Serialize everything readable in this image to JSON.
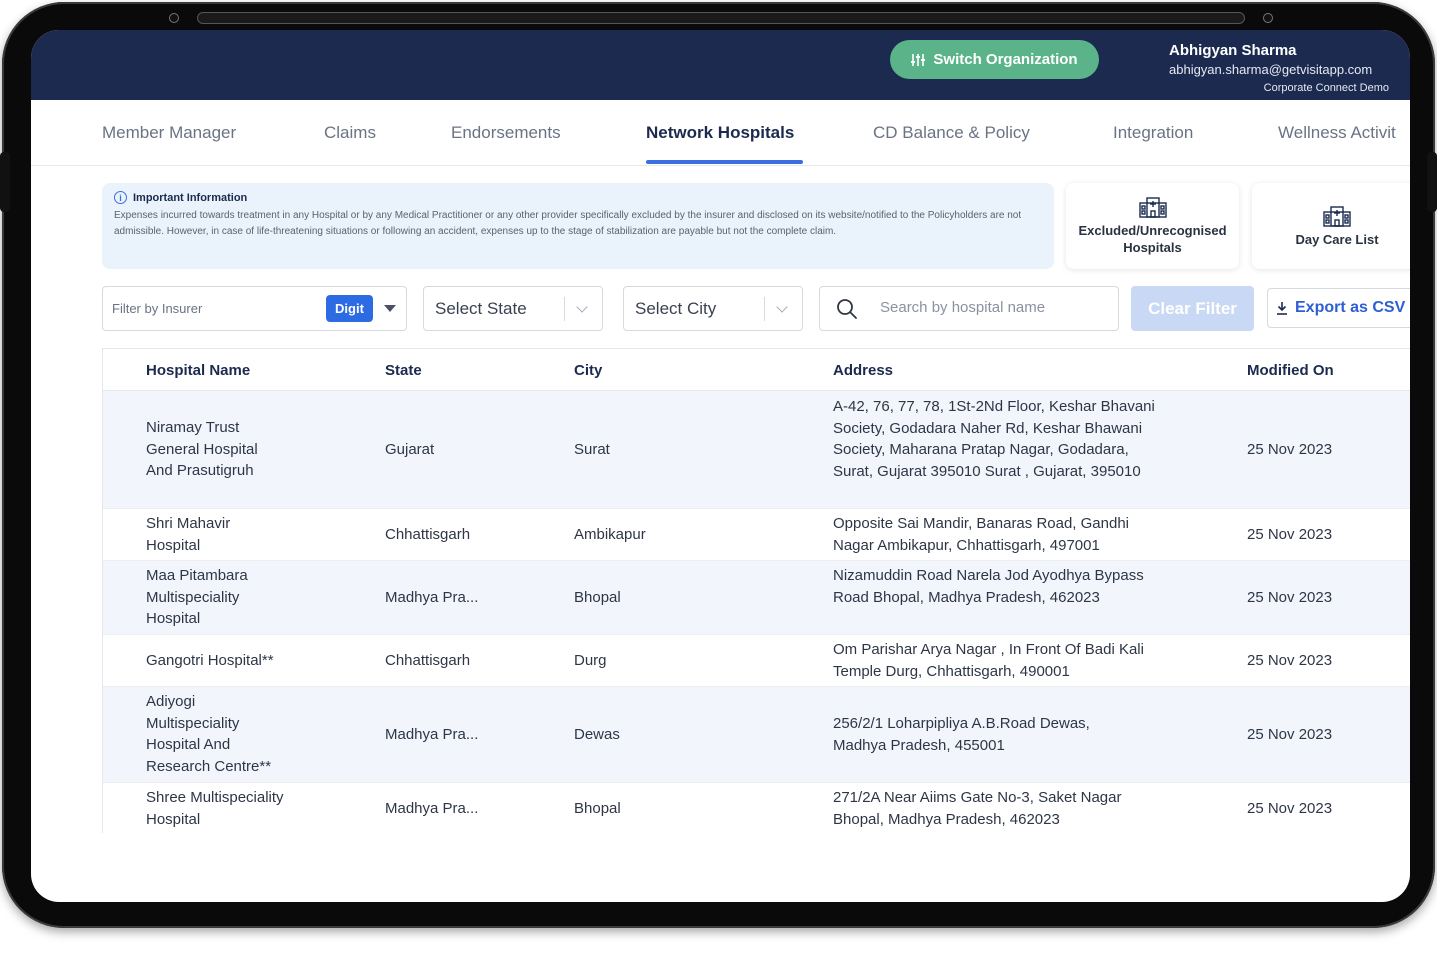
{
  "header": {
    "switch_label": "Switch Organization",
    "user_name": "Abhigyan Sharma",
    "user_email": "abhigyan.sharma@getvisitapp.com",
    "org_name": "Corporate Connect Demo"
  },
  "tabs": [
    {
      "label": "Member Manager"
    },
    {
      "label": "Claims"
    },
    {
      "label": "Endorsements"
    },
    {
      "label": "Network Hospitals"
    },
    {
      "label": "CD Balance & Policy"
    },
    {
      "label": "Integration"
    },
    {
      "label": "Wellness Activit"
    }
  ],
  "active_tab": "Network Hospitals",
  "info": {
    "title": "Important Information",
    "text": "Expenses incurred towards treatment in any Hospital or by any Medical Practitioner or any other provider specifically excluded by the insurer and disclosed on its website/notified to the Policyholders are not admissible. However, in case of life-threatening situations or following an accident, expenses up to the stage of stabilization are payable but not the complete claim."
  },
  "cards": {
    "excluded": "Excluded/Unrecognised Hospitals",
    "daycare": "Day Care List"
  },
  "filters": {
    "insurer_label": "Filter by Insurer",
    "insurer_chip": "Digit",
    "state_placeholder": "Select State",
    "city_placeholder": "Select City",
    "search_placeholder": "Search by hospital name",
    "clear_label": "Clear Filter",
    "export_label": "Export as CSV"
  },
  "table": {
    "columns": {
      "name": "Hospital Name",
      "state": "State",
      "city": "City",
      "address": "Address",
      "modified": "Modified On"
    },
    "rows": [
      {
        "name": "Niramay Trust General Hospital And Prasutigruh",
        "state": "Gujarat",
        "city": "Surat",
        "address": "A-42, 76, 77, 78, 1St-2Nd Floor, Keshar Bhavani Society, Godadara Naher Rd, Keshar Bhawani Society, Maharana Pratap Nagar, Godadara, Surat, Gujarat 395010 Surat , Gujarat, 395010",
        "modified": "25 Nov 2023"
      },
      {
        "name": "Shri Mahavir Hospital",
        "state": "Chhattisgarh",
        "city": "Ambikapur",
        "address": "Opposite Sai Mandir, Banaras Road, Gandhi Nagar Ambikapur, Chhattisgarh, 497001",
        "modified": "25 Nov 2023"
      },
      {
        "name": "Maa Pitambara Multispeciality Hospital",
        "state": "Madhya Pra...",
        "city": "Bhopal",
        "address": "Nizamuddin Road Narela Jod Ayodhya Bypass Road Bhopal, Madhya Pradesh, 462023",
        "modified": "25 Nov 2023"
      },
      {
        "name": "Gangotri Hospital**",
        "state": "Chhattisgarh",
        "city": "Durg",
        "address": "Om Parishar Arya Nagar , In Front Of Badi Kali Temple Durg, Chhattisgarh, 490001",
        "modified": "25 Nov 2023"
      },
      {
        "name": "Adiyogi Multispeciality Hospital And Research Centre**",
        "state": "Madhya Pra...",
        "city": "Dewas",
        "address": "256/2/1 Loharpipliya A.B.Road Dewas, Madhya Pradesh, 455001",
        "modified": "25 Nov 2023"
      },
      {
        "name": "Shree Multispeciality Hospital",
        "state": "Madhya Pra...",
        "city": "Bhopal",
        "address": "271/2A Near Aiims Gate No-3, Saket Nagar Bhopal, Madhya Pradesh, 462023",
        "modified": "25 Nov 2023"
      }
    ]
  },
  "colors": {
    "header_bg": "#1b2a4e",
    "switch_bg": "#5bb38a",
    "accent": "#3b6fe0",
    "row_alt": "#f2f6fc"
  }
}
